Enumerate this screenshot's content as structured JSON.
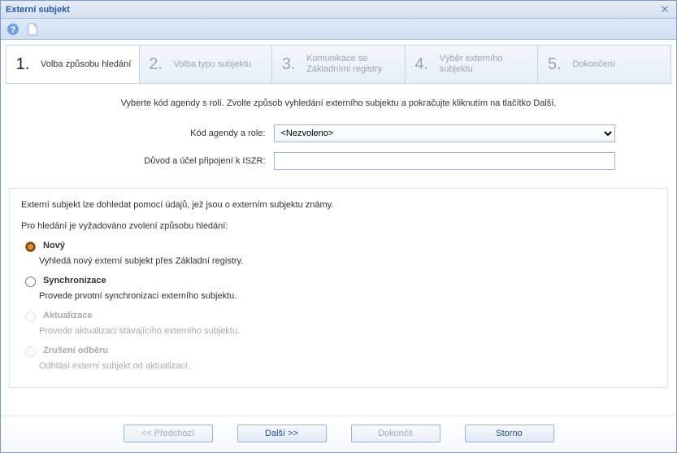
{
  "window": {
    "title": "Externí subjekt"
  },
  "steps": [
    {
      "num": "1.",
      "label": "Volba způsobu hledání"
    },
    {
      "num": "2.",
      "label": "Volba typu subjektu"
    },
    {
      "num": "3.",
      "label": "Komunikace se\nZákladními registry"
    },
    {
      "num": "4.",
      "label": "Výběr externího\nsubjektu"
    },
    {
      "num": "5.",
      "label": "Dokončení"
    }
  ],
  "instruction": "Vyberte kód agendy s rolí. Zvolte způsob vyhledání externího subjektu a pokračujte kliknutím na tlačítko Další.",
  "form": {
    "agenda_label": "Kód agendy a role:",
    "agenda_value": "<Nezvoleno>",
    "reason_label": "Důvod a účel připojení k ISZR:",
    "reason_value": ""
  },
  "panel": {
    "intro1": "Externí subjekt lze dohledat pomocí údajů, jež jsou o externím subjektu známy.",
    "intro2": "Pro hledání je vyžadováno zvolení způsobu hledání:",
    "options": [
      {
        "key": "novy",
        "label": "Nový",
        "desc": "Vyhledá nový externí subjekt přes Základní registry.",
        "enabled": true,
        "checked": true
      },
      {
        "key": "sync",
        "label": "Synchronizace",
        "desc": "Provede prvotní synchronizaci externího subjektu.",
        "enabled": true,
        "checked": false
      },
      {
        "key": "akt",
        "label": "Aktualizace",
        "desc": "Provede aktualizaci stávajícího externího subjektu.",
        "enabled": false,
        "checked": false
      },
      {
        "key": "zrus",
        "label": "Zrušení odběru",
        "desc": "Odhlásí externí subjekt od aktualizací.",
        "enabled": false,
        "checked": false
      }
    ]
  },
  "buttons": {
    "prev": "<< Předchozí",
    "next": "Další >>",
    "finish": "Dokončit",
    "cancel": "Storno"
  }
}
